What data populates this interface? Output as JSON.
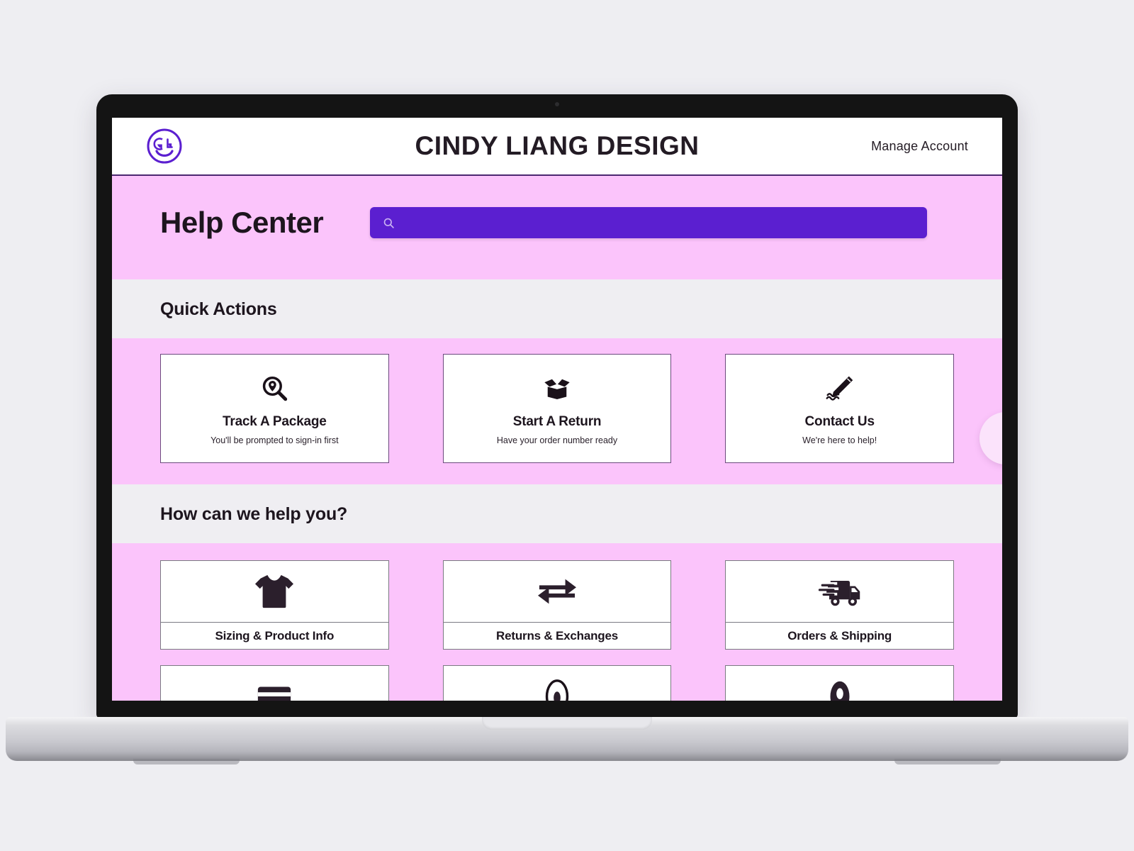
{
  "brand": {
    "name": "CINDY LIANG DESIGN",
    "logo_icon": "smiley-cl-logo-icon",
    "accent_purple": "#5b1fd0",
    "band_pink": "#fbc4fb",
    "band_gray": "#efeef2"
  },
  "header": {
    "manage_account": "Manage Account"
  },
  "hero": {
    "title": "Help Center",
    "search": {
      "icon": "search-icon",
      "value": "",
      "placeholder": ""
    }
  },
  "quick_actions": {
    "heading": "Quick Actions",
    "items": [
      {
        "icon": "package-tracking-icon",
        "title": "Track A Package",
        "subtitle": "You'll be prompted to sign-in first"
      },
      {
        "icon": "open-box-icon",
        "title": "Start A Return",
        "subtitle": "Have your order number ready"
      },
      {
        "icon": "pencil-signature-icon",
        "title": "Contact Us",
        "subtitle": "We're here to help!"
      }
    ]
  },
  "help_topics": {
    "heading": "How can we help you?",
    "items": [
      {
        "icon": "tshirt-icon",
        "label": "Sizing & Product Info"
      },
      {
        "icon": "exchange-arrows-icon",
        "label": "Returns & Exchanges"
      },
      {
        "icon": "delivery-truck-icon",
        "label": "Orders & Shipping"
      }
    ],
    "items_partial": [
      {
        "icon": "credit-card-icon",
        "label": ""
      },
      {
        "icon": "eye-icon",
        "label": ""
      },
      {
        "icon": "account-person-icon",
        "label": ""
      }
    ]
  },
  "decor": {
    "bubble": "floating-pink-circle"
  }
}
